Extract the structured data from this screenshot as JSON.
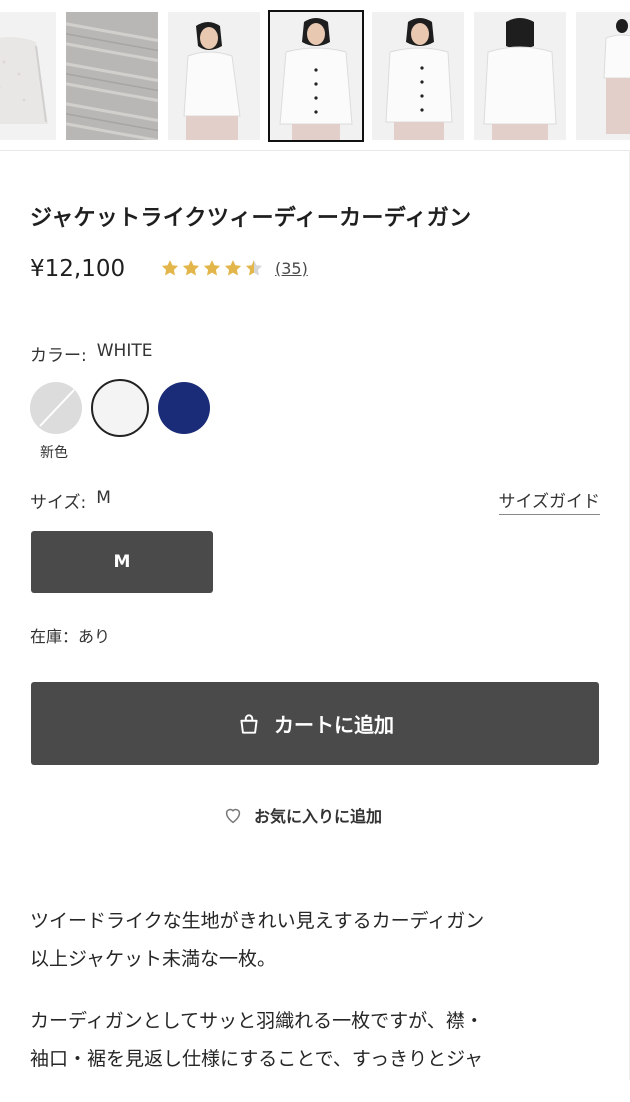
{
  "thumbnails": [
    {
      "name": "thumb-cardigan-flat"
    },
    {
      "name": "thumb-fabric-closeup"
    },
    {
      "name": "thumb-model-side"
    },
    {
      "name": "thumb-model-front",
      "selected": true
    },
    {
      "name": "thumb-model-three-quarter"
    },
    {
      "name": "thumb-model-back"
    },
    {
      "name": "thumb-model-full"
    }
  ],
  "product": {
    "title": "ジャケットライクツィーディーカーディガン",
    "price": "¥12,100",
    "rating_value": 4.5,
    "review_count": "(35)"
  },
  "color": {
    "label": "カラー:",
    "selected": "WHITE",
    "swatches": [
      {
        "name": "grey",
        "hex": "#dcdcdc"
      },
      {
        "name": "white",
        "hex": "#f4f4f4",
        "selected": true
      },
      {
        "name": "navy",
        "hex": "#1a2c78"
      }
    ],
    "new_label": "新色"
  },
  "size": {
    "label": "サイズ:",
    "selected": "M",
    "guide_label": "サイズガイド",
    "options": [
      "M"
    ]
  },
  "stock_text": "在庫：あり",
  "cart": {
    "button_label": "カートに追加",
    "icon": "shopping-bag-icon"
  },
  "favorite": {
    "label": "お気に入りに追加",
    "icon": "heart-icon"
  },
  "description": {
    "line1": "ツイードライクな生地がきれい見えするカーディガン",
    "line2": "以上ジャケット未満な一枚。",
    "line3": "カーディガンとしてサッと羽織れる一枚ですが、襟・",
    "line4": "袖口・裾を見返し仕様にすることで、すっきりとジャ"
  },
  "colors": {
    "button_bg": "#4a4a4a",
    "star_gold": "#e2b64a",
    "navy": "#1a2c78"
  }
}
